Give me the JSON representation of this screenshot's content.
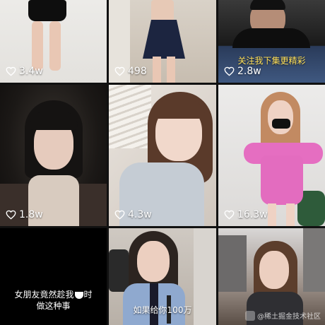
{
  "grid": {
    "items": [
      {
        "likes": "3.4w"
      },
      {
        "likes": "498"
      },
      {
        "likes": "2.8w",
        "caption": "关注我下集更精彩"
      },
      {
        "likes": "1.8w"
      },
      {
        "likes": "4.3w"
      },
      {
        "likes": "16.3w"
      },
      {
        "caption_line1_a": "女朋友竟然趁我",
        "caption_line1_b": "时",
        "caption_line2": "做这种事"
      },
      {
        "caption": "如果给你100万"
      },
      {
        "watermark": "@稀土掘金技术社区"
      }
    ]
  },
  "colors": {
    "background": "#0b0b0b",
    "text": "#ffffff",
    "caption_yellow": "#ffe05a"
  },
  "icons": {
    "likes": "heart-outline-icon",
    "watermark": "app-logo-icon"
  }
}
